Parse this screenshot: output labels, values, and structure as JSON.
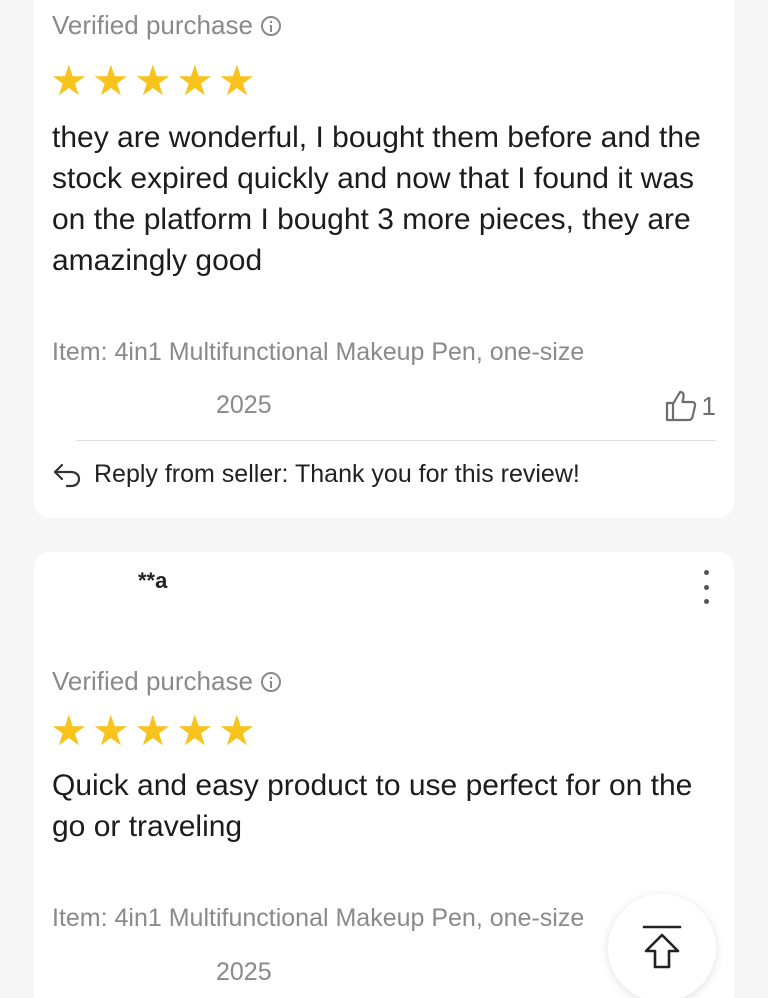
{
  "reviews": [
    {
      "verified_label": "Verified purchase",
      "rating": 5,
      "text": "they are wonderful, I bought them before and the stock expired quickly and now that I found it was on the platform I bought 3 more pieces, they are amazingly good",
      "item": "Item: 4in1 Multifunctional Makeup Pen, one-size",
      "date": "2025",
      "helpful_count": "1",
      "reply": "Reply from seller: Thank you for this review!"
    },
    {
      "username": "**a",
      "verified_label": "Verified purchase",
      "rating": 5,
      "text": "Quick and easy product to use perfect for on the go or traveling",
      "item": "Item: 4in1 Multifunctional Makeup Pen, one-size",
      "date": "2025"
    }
  ],
  "icons": {
    "star_color": "#f7c31c",
    "info": "info-icon",
    "thumbs_up": "thumbs-up-icon",
    "reply": "reply-arrow-icon",
    "more": "more-vertical-icon",
    "back_to_top": "back-to-top-icon"
  }
}
